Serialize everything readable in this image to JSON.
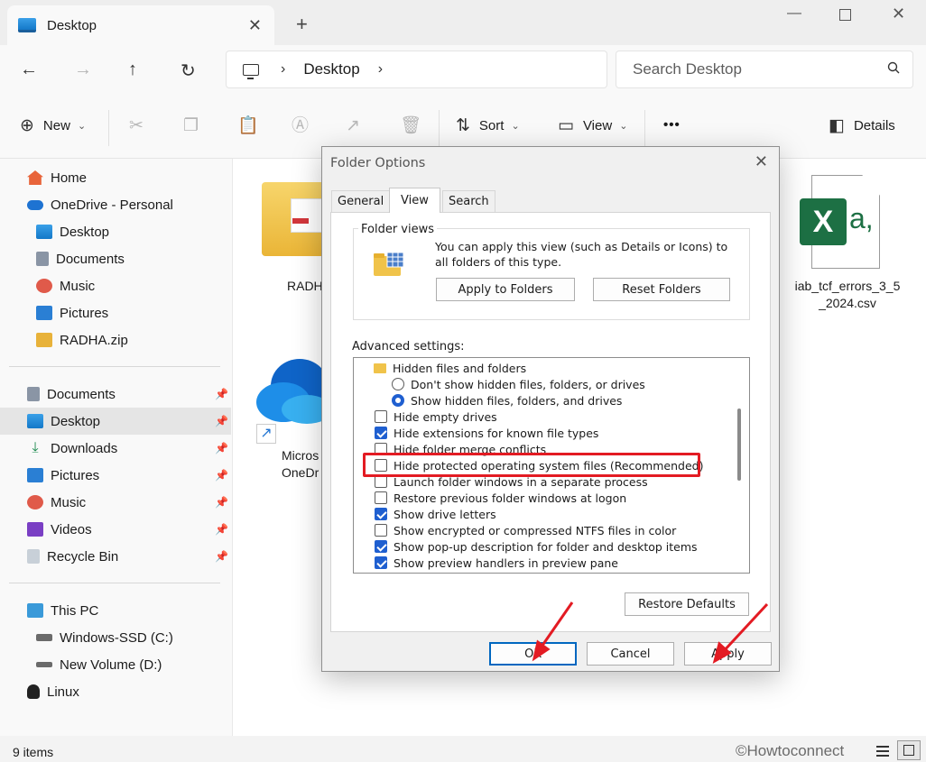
{
  "window": {
    "tab_title": "Desktop",
    "tab_close": "✕",
    "new_tab": "+"
  },
  "toolbar": {
    "address_segment": "Desktop",
    "search_placeholder": "Search Desktop"
  },
  "commands": {
    "new_label": "New",
    "sort_label": "Sort",
    "view_label": "View",
    "more_label": "•••",
    "details_label": "Details"
  },
  "sidebar": {
    "items": [
      {
        "label": "Home"
      },
      {
        "label": "OneDrive - Personal"
      },
      {
        "label": "Desktop"
      },
      {
        "label": "Documents"
      },
      {
        "label": "Music"
      },
      {
        "label": "Pictures"
      },
      {
        "label": "RADHA.zip"
      }
    ],
    "quick_access": [
      {
        "label": "Documents"
      },
      {
        "label": "Desktop"
      },
      {
        "label": "Downloads"
      },
      {
        "label": "Pictures"
      },
      {
        "label": "Music"
      },
      {
        "label": "Videos"
      },
      {
        "label": "Recycle Bin"
      }
    ],
    "pc_items": [
      {
        "label": "This PC"
      },
      {
        "label": "Windows-SSD (C:)"
      },
      {
        "label": "New Volume (D:)"
      },
      {
        "label": "Linux"
      }
    ]
  },
  "content": {
    "files": [
      {
        "label": "RADH"
      },
      {
        "label": "Micros\nOneDr"
      },
      {
        "label": "iab_tcf_errors_3_5\n_2024.csv"
      }
    ]
  },
  "status": {
    "item_count": "9 items",
    "watermark": "©Howtoconnect"
  },
  "dialog": {
    "title": "Folder Options",
    "tabs": [
      "General",
      "View",
      "Search"
    ],
    "folder_views": {
      "label": "Folder views",
      "description": "You can apply this view (such as Details or Icons) to all folders of this type.",
      "apply_button": "Apply to Folders",
      "reset_button": "Reset Folders"
    },
    "advanced_label": "Advanced settings:",
    "settings": [
      {
        "kind": "folder",
        "label": "Hidden files and folders"
      },
      {
        "kind": "radio",
        "checked": false,
        "label": "Don't show hidden files, folders, or drives"
      },
      {
        "kind": "radio",
        "checked": true,
        "label": "Show hidden files, folders, and drives"
      },
      {
        "kind": "check",
        "checked": false,
        "label": "Hide empty drives"
      },
      {
        "kind": "check",
        "checked": true,
        "label": "Hide extensions for known file types"
      },
      {
        "kind": "check",
        "checked": false,
        "label": "Hide folder merge conflicts"
      },
      {
        "kind": "check",
        "checked": false,
        "label": "Hide protected operating system files (Recommended)"
      },
      {
        "kind": "check",
        "checked": false,
        "label": "Launch folder windows in a separate process"
      },
      {
        "kind": "check",
        "checked": false,
        "label": "Restore previous folder windows at logon"
      },
      {
        "kind": "check",
        "checked": true,
        "label": "Show drive letters"
      },
      {
        "kind": "check",
        "checked": false,
        "label": "Show encrypted or compressed NTFS files in color"
      },
      {
        "kind": "check",
        "checked": true,
        "label": "Show pop-up description for folder and desktop items"
      },
      {
        "kind": "check",
        "checked": true,
        "label": "Show preview handlers in preview pane"
      }
    ],
    "restore_defaults": "Restore Defaults",
    "ok": "OK",
    "cancel": "Cancel",
    "apply": "Apply"
  },
  "colors": {
    "highlight": "#e31b23",
    "accent": "#1f5fd0",
    "excel_green": "#1d7044"
  }
}
